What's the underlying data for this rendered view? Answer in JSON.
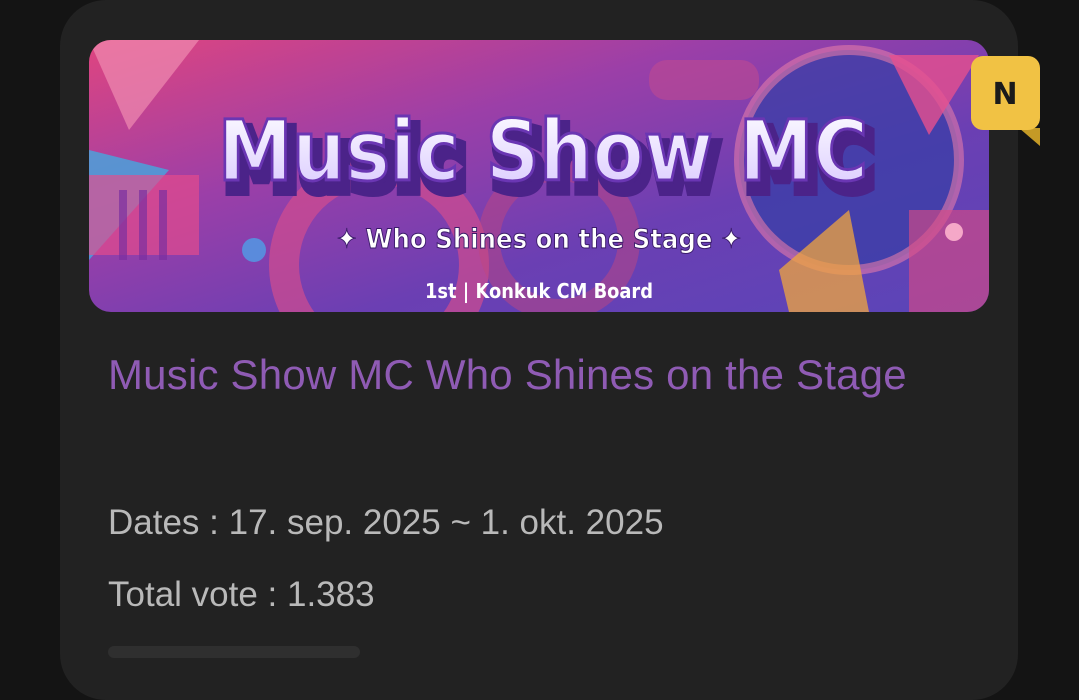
{
  "event_card": {
    "banner": {
      "headline": "Music Show MC",
      "tagline": "✦ Who Shines on the Stage ✦",
      "footer": "1st | Konkuk CM Board"
    },
    "badge_label": "N",
    "title": "Music Show MC Who Shines on the Stage",
    "dates_label": "Dates : ",
    "dates_value": "17. sep. 2025 ~ 1. okt. 2025",
    "votes_label": "Total vote : ",
    "votes_value": "1.383"
  },
  "colors": {
    "page_background": "#141414",
    "card_background": "#222222",
    "title": "#8f5bb4",
    "info_text": "#b9b9b9",
    "badge": "#f1c244",
    "banner_headline": "#efe6ff",
    "banner_headline_outline": "#5b2d9e"
  }
}
